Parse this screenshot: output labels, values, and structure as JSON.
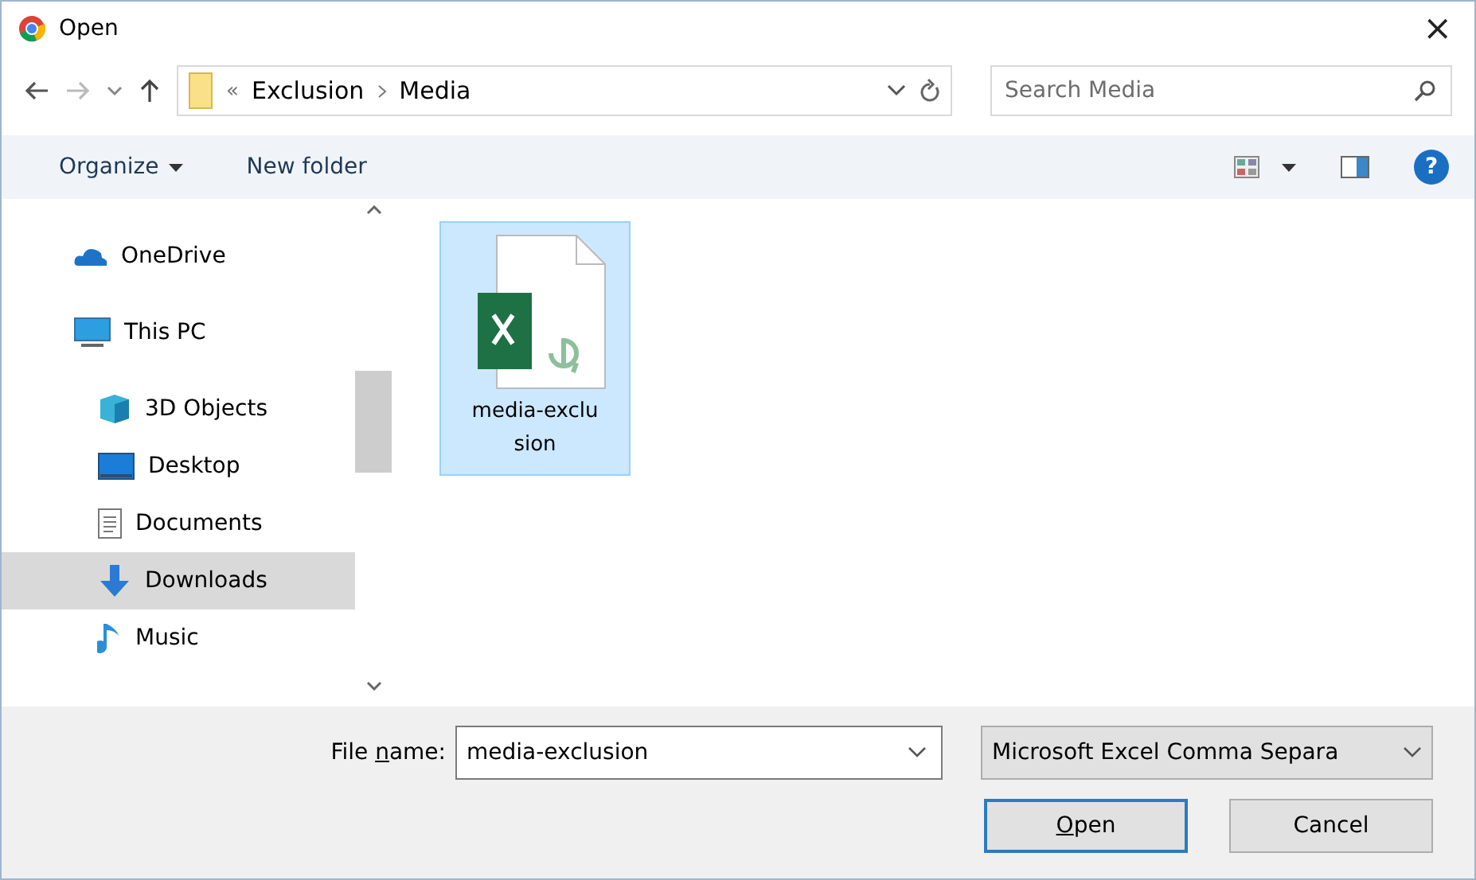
{
  "window": {
    "title": "Open",
    "close": "×"
  },
  "address": {
    "overflow": "«",
    "path": [
      "Exclusion",
      "Media"
    ]
  },
  "search": {
    "placeholder": "Search Media"
  },
  "toolbar": {
    "organize": "Organize",
    "new_folder": "New folder",
    "help": "?"
  },
  "sidebar": {
    "items": [
      {
        "label": "OneDrive",
        "selected": false
      },
      {
        "label": "This PC",
        "selected": false,
        "children": [
          {
            "label": "3D Objects",
            "selected": false
          },
          {
            "label": "Desktop",
            "selected": false
          },
          {
            "label": "Documents",
            "selected": false
          },
          {
            "label": "Downloads",
            "selected": true
          },
          {
            "label": "Music",
            "selected": false
          }
        ]
      }
    ]
  },
  "files": [
    {
      "name": "media-exclusion",
      "selected": true
    }
  ],
  "file_name": {
    "label": {
      "pre": "File ",
      "key": "n",
      "post": "ame:"
    },
    "value": "media-exclusion"
  },
  "file_type": {
    "value": "Microsoft Excel Comma Separa"
  },
  "buttons": [
    {
      "label": {
        "key": "O",
        "post": "pen"
      },
      "default": true
    },
    {
      "label": {
        "pre": "Cancel"
      },
      "default": false
    }
  ]
}
